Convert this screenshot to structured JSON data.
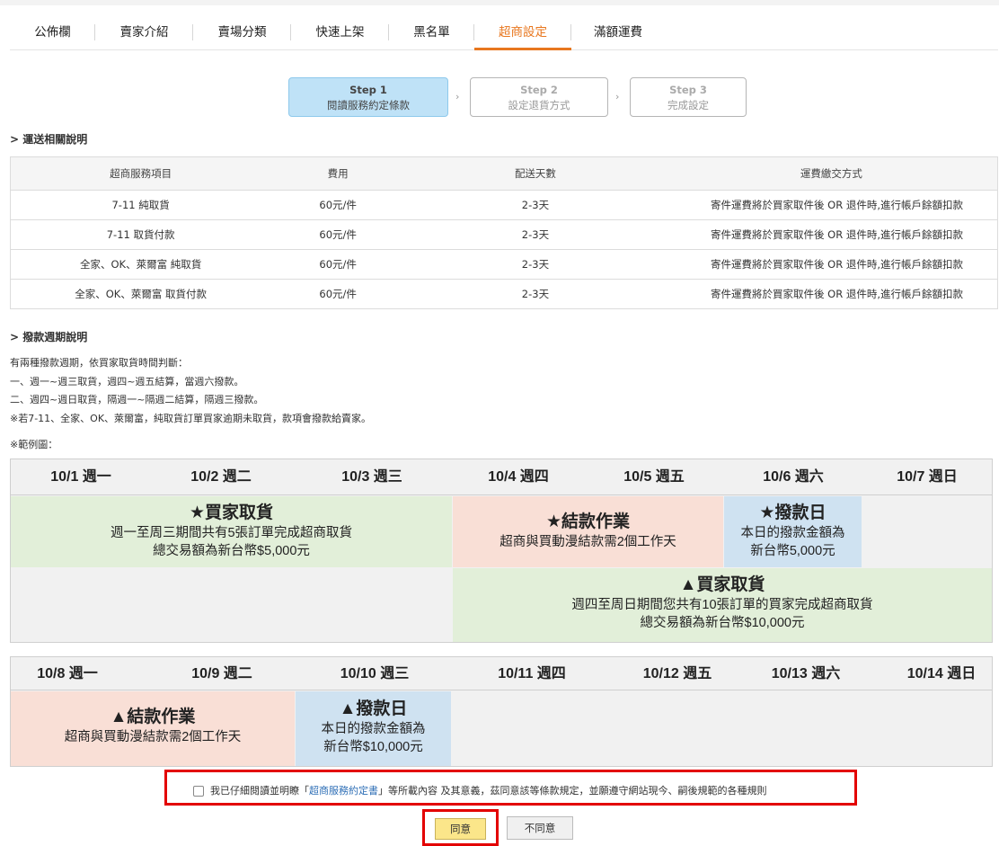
{
  "tabs": [
    "公佈欄",
    "賣家介紹",
    "賣場分類",
    "快速上架",
    "黑名單",
    "超商設定",
    "滿額運費"
  ],
  "active_tab": "超商設定",
  "steps": [
    {
      "title": "Step 1",
      "sub": "閱讀服務約定條款"
    },
    {
      "title": "Step 2",
      "sub": "設定退貨方式"
    },
    {
      "title": "Step 3",
      "sub": "完成設定"
    }
  ],
  "step_arrow": "›",
  "shipping_title": "> 運送相關說明",
  "fee_table": {
    "headers": [
      "超商服務項目",
      "費用",
      "配送天數",
      "運費繳交方式"
    ],
    "rows": [
      [
        "7-11 純取貨",
        "60元/件",
        "2-3天",
        "寄件運費將於買家取件後 OR 退件時,進行帳戶餘額扣款"
      ],
      [
        "7-11 取貨付款",
        "60元/件",
        "2-3天",
        "寄件運費將於買家取件後 OR 退件時,進行帳戶餘額扣款"
      ],
      [
        "全家、OK、萊爾富 純取貨",
        "60元/件",
        "2-3天",
        "寄件運費將於買家取件後 OR 退件時,進行帳戶餘額扣款"
      ],
      [
        "全家、OK、萊爾富 取貨付款",
        "60元/件",
        "2-3天",
        "寄件運費將於買家取件後 OR 退件時,進行帳戶餘額扣款"
      ]
    ]
  },
  "payout_title": "> 撥款週期說明",
  "payout_lines": [
    "有兩種撥款週期，依買家取貨時間判斷：",
    "一、週一~週三取貨，週四~週五結算，當週六撥款。",
    "二、週四~週日取貨，隔週一~隔週二結算，隔週三撥款。",
    "※若7-11、全家、OK、萊爾富，純取貨訂單買家逾期未取貨，款項會撥款給賣家。"
  ],
  "sample_label": "※範例圖：",
  "week1": {
    "days": [
      "10/1 週一",
      "10/2 週二",
      "10/3 週三",
      "10/4 週四",
      "10/5 週五",
      "10/6 週六",
      "10/7 週日"
    ],
    "b1": {
      "title": "★買家取貨",
      "l1": "週一至周三期間共有5張訂單完成超商取貨",
      "l2": "總交易額為新台幣$5,000元"
    },
    "b2": {
      "title": "★結款作業",
      "l1": "超商與買動漫結款需2個工作天"
    },
    "b3": {
      "title": "★撥款日",
      "l1": "本日的撥款金額為",
      "l2": "新台幣5,000元"
    },
    "b4": {
      "title": "▲買家取貨",
      "l1": "週四至周日期間您共有10張訂單的買家完成超商取貨",
      "l2": "總交易額為新台幣$10,000元"
    }
  },
  "week2": {
    "days": [
      "10/8 週一",
      "10/9 週二",
      "10/10 週三",
      "10/11 週四",
      "10/12 週五",
      "10/13 週六",
      "10/14 週日"
    ],
    "b1": {
      "title": "▲結款作業",
      "l1": "超商與買動漫結款需2個工作天"
    },
    "b2": {
      "title": "▲撥款日",
      "l1": "本日的撥款金額為",
      "l2": "新台幣$10,000元"
    }
  },
  "agree": {
    "pre": "我已仔細閱讀並明瞭「",
    "link": "超商服務約定書",
    "post": "」等所載內容 及其意義，茲同意該等條款規定，並願遵守網站現今、嗣後規範的各種規則",
    "checked": false
  },
  "buttons": {
    "agree": "同意",
    "disagree": "不同意"
  },
  "colors": {
    "accent": "#e8771f",
    "step_active": "#bfe2f7",
    "green": "#e2efd9",
    "pink": "#f9dfd6",
    "blue": "#cfe2f1",
    "highlight": "#e30000"
  }
}
